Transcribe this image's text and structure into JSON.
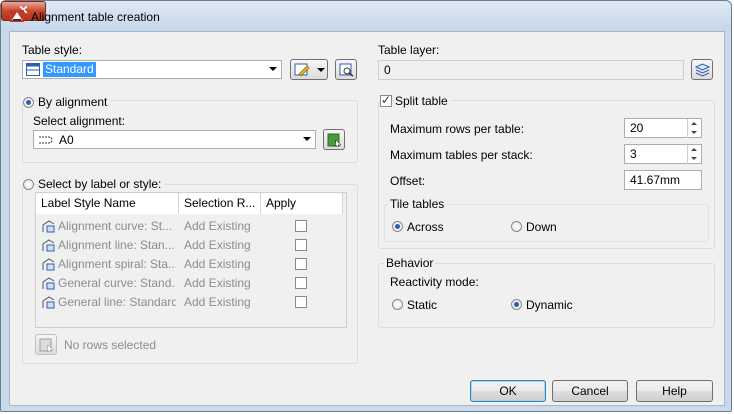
{
  "window": {
    "title": "Alignment table creation"
  },
  "table_style": {
    "label": "Table style:",
    "value": "Standard"
  },
  "table_layer": {
    "label": "Table layer:",
    "value": "0"
  },
  "by_alignment": {
    "label": "By alignment",
    "selected": true,
    "select_label": "Select alignment:",
    "alignment_value": "A0"
  },
  "by_label": {
    "label": "Select by label or style:",
    "selected": false,
    "columns": [
      "Label Style Name",
      "Selection R...",
      "Apply"
    ],
    "rows": [
      {
        "name": "Alignment curve: St...",
        "rule": "Add Existing",
        "apply": false
      },
      {
        "name": "Alignment line: Stan...",
        "rule": "Add Existing",
        "apply": false
      },
      {
        "name": "Alignment spiral: Sta...",
        "rule": "Add Existing",
        "apply": false
      },
      {
        "name": "General curve: Stand...",
        "rule": "Add Existing",
        "apply": false
      },
      {
        "name": "General line: Standard",
        "rule": "Add Existing",
        "apply": false
      }
    ],
    "status": "No rows selected"
  },
  "split_table": {
    "label": "Split table",
    "checked": true,
    "max_rows_label": "Maximum rows per table:",
    "max_rows_value": "20",
    "max_tables_label": "Maximum tables per stack:",
    "max_tables_value": "3",
    "offset_label": "Offset:",
    "offset_value": "41.67mm",
    "tile_label": "Tile tables",
    "tile_options": [
      "Across",
      "Down"
    ],
    "tile_selected": "Across"
  },
  "behavior": {
    "label": "Behavior",
    "reactivity_label": "Reactivity mode:",
    "options": [
      "Static",
      "Dynamic"
    ],
    "selected": "Dynamic"
  },
  "buttons": {
    "ok": "OK",
    "cancel": "Cancel",
    "help": "Help"
  },
  "colors": {
    "accent": "#2b5fb5",
    "titlebar": "#c9d9ea",
    "close": "#c6452c",
    "disabled_text": "#8d8d8d"
  }
}
